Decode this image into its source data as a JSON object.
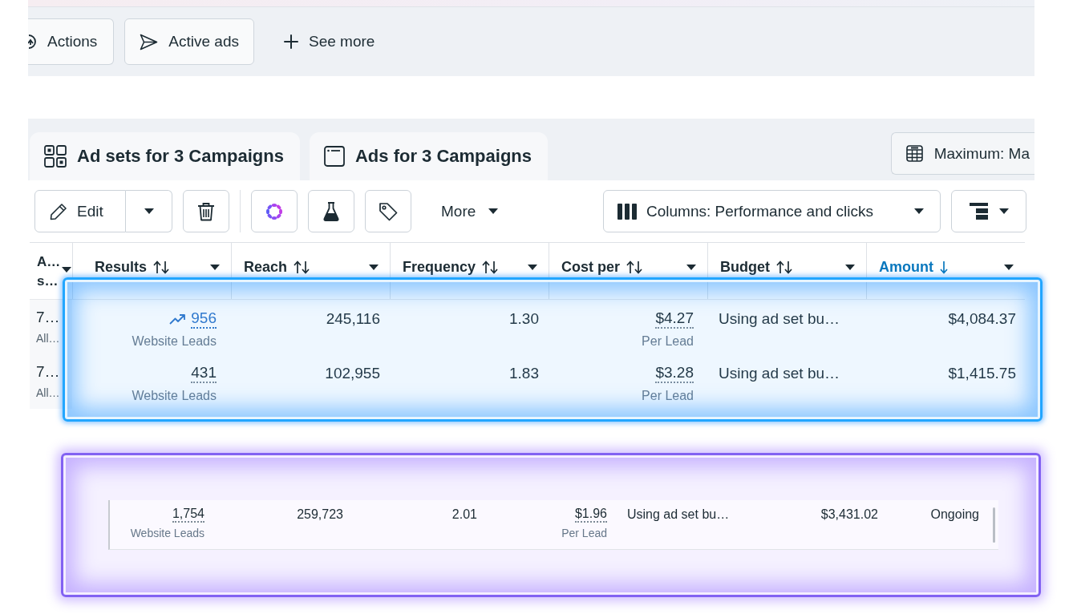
{
  "filter_bar": {
    "buttons": [
      {
        "label": "Actions",
        "kind": "outlined"
      },
      {
        "label": "Active ads",
        "kind": "outlined"
      },
      {
        "label": "See more",
        "kind": "plain"
      }
    ]
  },
  "tabs": [
    {
      "label": "Ad sets for 3 Campaigns"
    },
    {
      "label": "Ads for 3 Campaigns"
    }
  ],
  "attribution_button": {
    "label": "Maximum: Ma"
  },
  "toolbar": {
    "edit_button": "Edit",
    "more_button": "More",
    "columns_button": "Columns: Performance and clicks"
  },
  "table": {
    "columns": [
      {
        "label": "A…",
        "label_2": "s…",
        "sortable": false,
        "sorted": false
      },
      {
        "label": "Results",
        "sortable": true,
        "sorted": false
      },
      {
        "label": "Reach",
        "sortable": true,
        "sorted": false
      },
      {
        "label": "Frequency",
        "sortable": true,
        "sorted": false
      },
      {
        "label": "Cost per",
        "sortable": true,
        "sorted": false
      },
      {
        "label": "Budget",
        "sortable": true,
        "sorted": false
      },
      {
        "label": "Amount",
        "sortable": true,
        "sorted": true
      }
    ],
    "rows": [
      {
        "column_1": [
          "7…",
          "All…"
        ],
        "results": {
          "value": "956",
          "label": "Website Leads",
          "trend": true
        },
        "reach": "245,116",
        "frequency": "1.30",
        "cost_per_result": {
          "value": "$4.27",
          "label": "Per Lead"
        },
        "budget": "Using ad set bu…",
        "amount_spent": "$4,084.37"
      },
      {
        "column_1": [
          "7…",
          "All…"
        ],
        "results": {
          "value": "431",
          "label": "Website Leads",
          "trend": false
        },
        "reach": "102,955",
        "frequency": "1.83",
        "cost_per_result": {
          "value": "$3.28",
          "label": "Per Lead"
        },
        "budget": "Using ad set bu…",
        "amount_spent": "$1,415.75"
      }
    ]
  },
  "highlighted_row": {
    "results": {
      "value": "1,754",
      "label": "Website Leads",
      "trend": false
    },
    "reach": "259,723",
    "frequency": "2.01",
    "cost_per_result": {
      "value": "$1.96",
      "label": "Per Lead"
    },
    "budget": "Using ad set bu…",
    "amount_spent": "$3,431.02",
    "column_8": "Ongoing"
  }
}
